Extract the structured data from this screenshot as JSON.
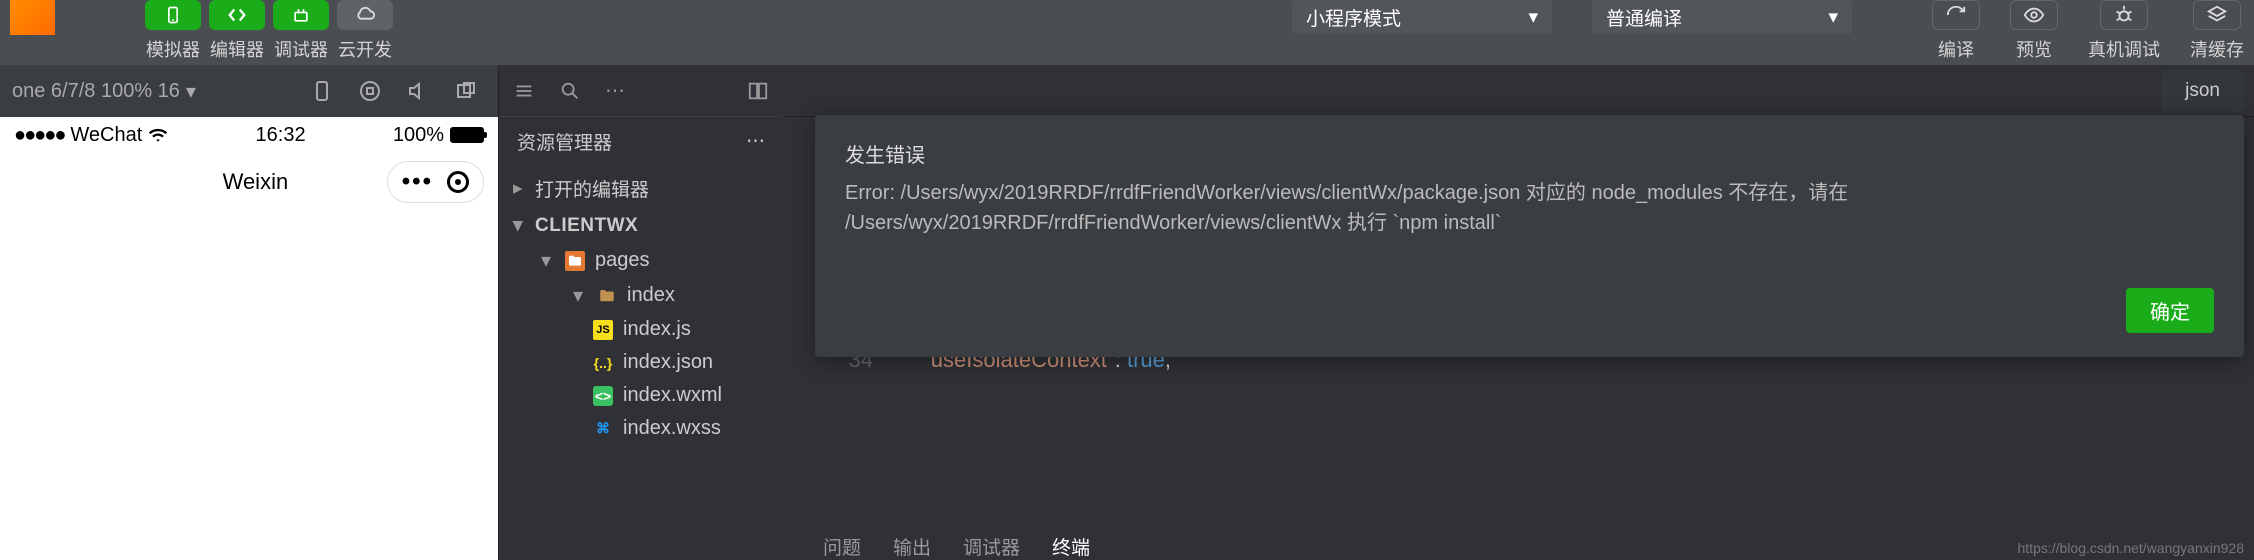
{
  "toolbar": {
    "simulator": "模拟器",
    "editor": "编辑器",
    "debugger": "调试器",
    "cloud": "云开发",
    "mode_label": "小程序模式",
    "compile_mode": "普通编译",
    "compile": "编译",
    "preview": "预览",
    "remote_debug": "真机调试",
    "clear_cache": "清缓存"
  },
  "simulator": {
    "device": "one 6/7/8 100% 16",
    "carrier": "WeChat",
    "time": "16:32",
    "battery": "100%",
    "title": "Weixin"
  },
  "explorer": {
    "title": "资源管理器",
    "open_editors": "打开的编辑器",
    "project": "CLIENTWX",
    "pages": "pages",
    "index_folder": "index",
    "files": {
      "js": "index.js",
      "json": "index.json",
      "wxml": "index.wxml",
      "wxss": "index.wxss"
    }
  },
  "editor": {
    "tab": "json",
    "line_num": "34",
    "code_key": "\"useIsolateContext\"",
    "code_val": "true",
    "bottom_tabs": {
      "problems": "问题",
      "output": "输出",
      "debugger": "调试器",
      "terminal": "终端"
    }
  },
  "error": {
    "title": "发生错误",
    "body": "Error: /Users/wyx/2019RRDF/rrdfFriendWorker/views/clientWx/package.json 对应的 node_modules 不存在，请在 /Users/wyx/2019RRDF/rrdfFriendWorker/views/clientWx 执行 `npm install`",
    "ok": "确定"
  },
  "watermark": "https://blog.csdn.net/wangyanxin928"
}
